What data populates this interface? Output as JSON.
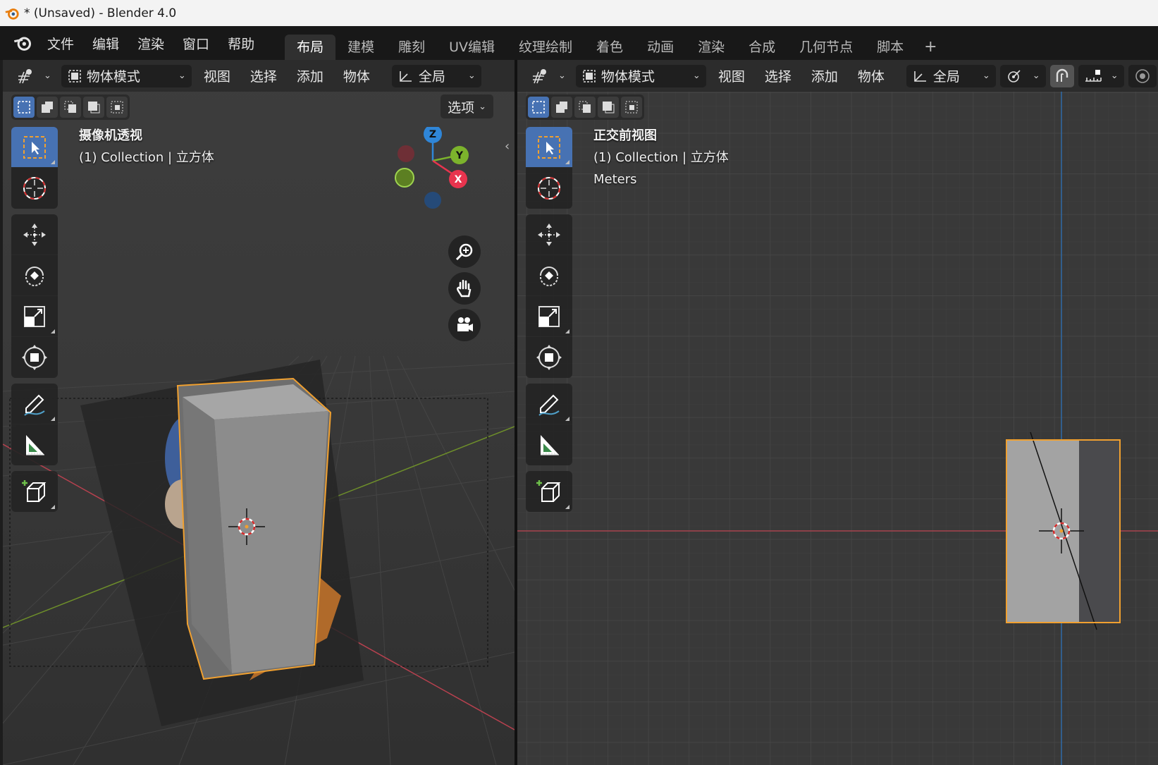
{
  "window": {
    "title": "* (Unsaved) - Blender 4.0"
  },
  "menu": [
    "文件",
    "编辑",
    "渲染",
    "窗口",
    "帮助"
  ],
  "workspaces": [
    {
      "label": "布局",
      "active": true
    },
    {
      "label": "建模"
    },
    {
      "label": "雕刻"
    },
    {
      "label": "UV编辑"
    },
    {
      "label": "纹理绘制"
    },
    {
      "label": "着色"
    },
    {
      "label": "动画"
    },
    {
      "label": "渲染"
    },
    {
      "label": "合成"
    },
    {
      "label": "几何节点"
    },
    {
      "label": "脚本"
    }
  ],
  "workspace_add": "+",
  "left_viewport": {
    "mode": "物体模式",
    "menus": [
      "视图",
      "选择",
      "添加",
      "物体"
    ],
    "transform_orientation": "全局",
    "options": "选项",
    "view_name": "摄像机透视",
    "collection": "(1) Collection | 立方体",
    "gizmo": {
      "z": "Z",
      "y": "Y",
      "x": "X"
    }
  },
  "right_viewport": {
    "mode": "物体模式",
    "menus": [
      "视图",
      "选择",
      "添加",
      "物体"
    ],
    "transform_orientation": "全局",
    "view_name": "正交前视图",
    "collection": "(1) Collection | 立方体",
    "units": "Meters"
  },
  "colors": {
    "accent": "#4772b3",
    "selection_outline": "#f0a030",
    "x_axis": "#e8344e",
    "y_axis": "#7cb32c",
    "z_axis": "#2f86d8"
  }
}
